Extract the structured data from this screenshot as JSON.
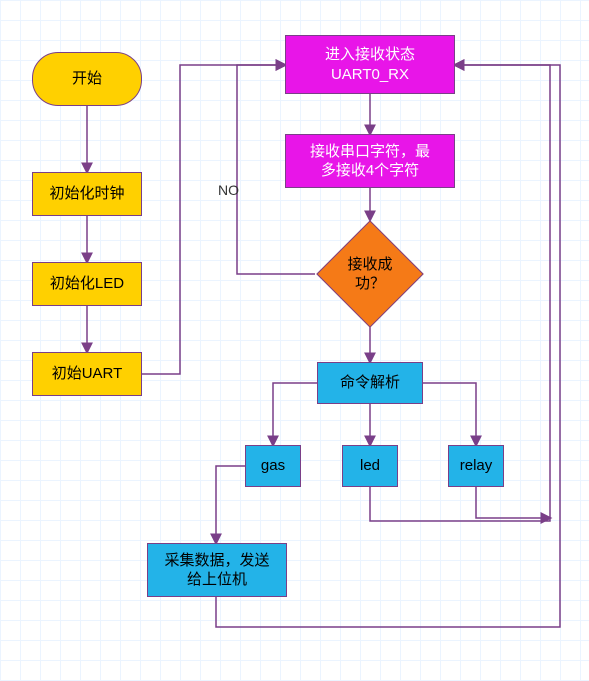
{
  "nodes": {
    "start": "开始",
    "init_clock": "初始化时钟",
    "init_led": "初始化LED",
    "init_uart": "初始UART",
    "rx_state": "进入接收状态\nUART0_RX",
    "rx_chars": "接收串口字符，最\n多接收4个字符",
    "rx_ok": "接收成\n功？",
    "cmd_parse": "命令解析",
    "gas": "gas",
    "led": "led",
    "relay": "relay",
    "collect_send": "采集数据，发送\n给上位机"
  },
  "edge_labels": {
    "no": "NO"
  }
}
